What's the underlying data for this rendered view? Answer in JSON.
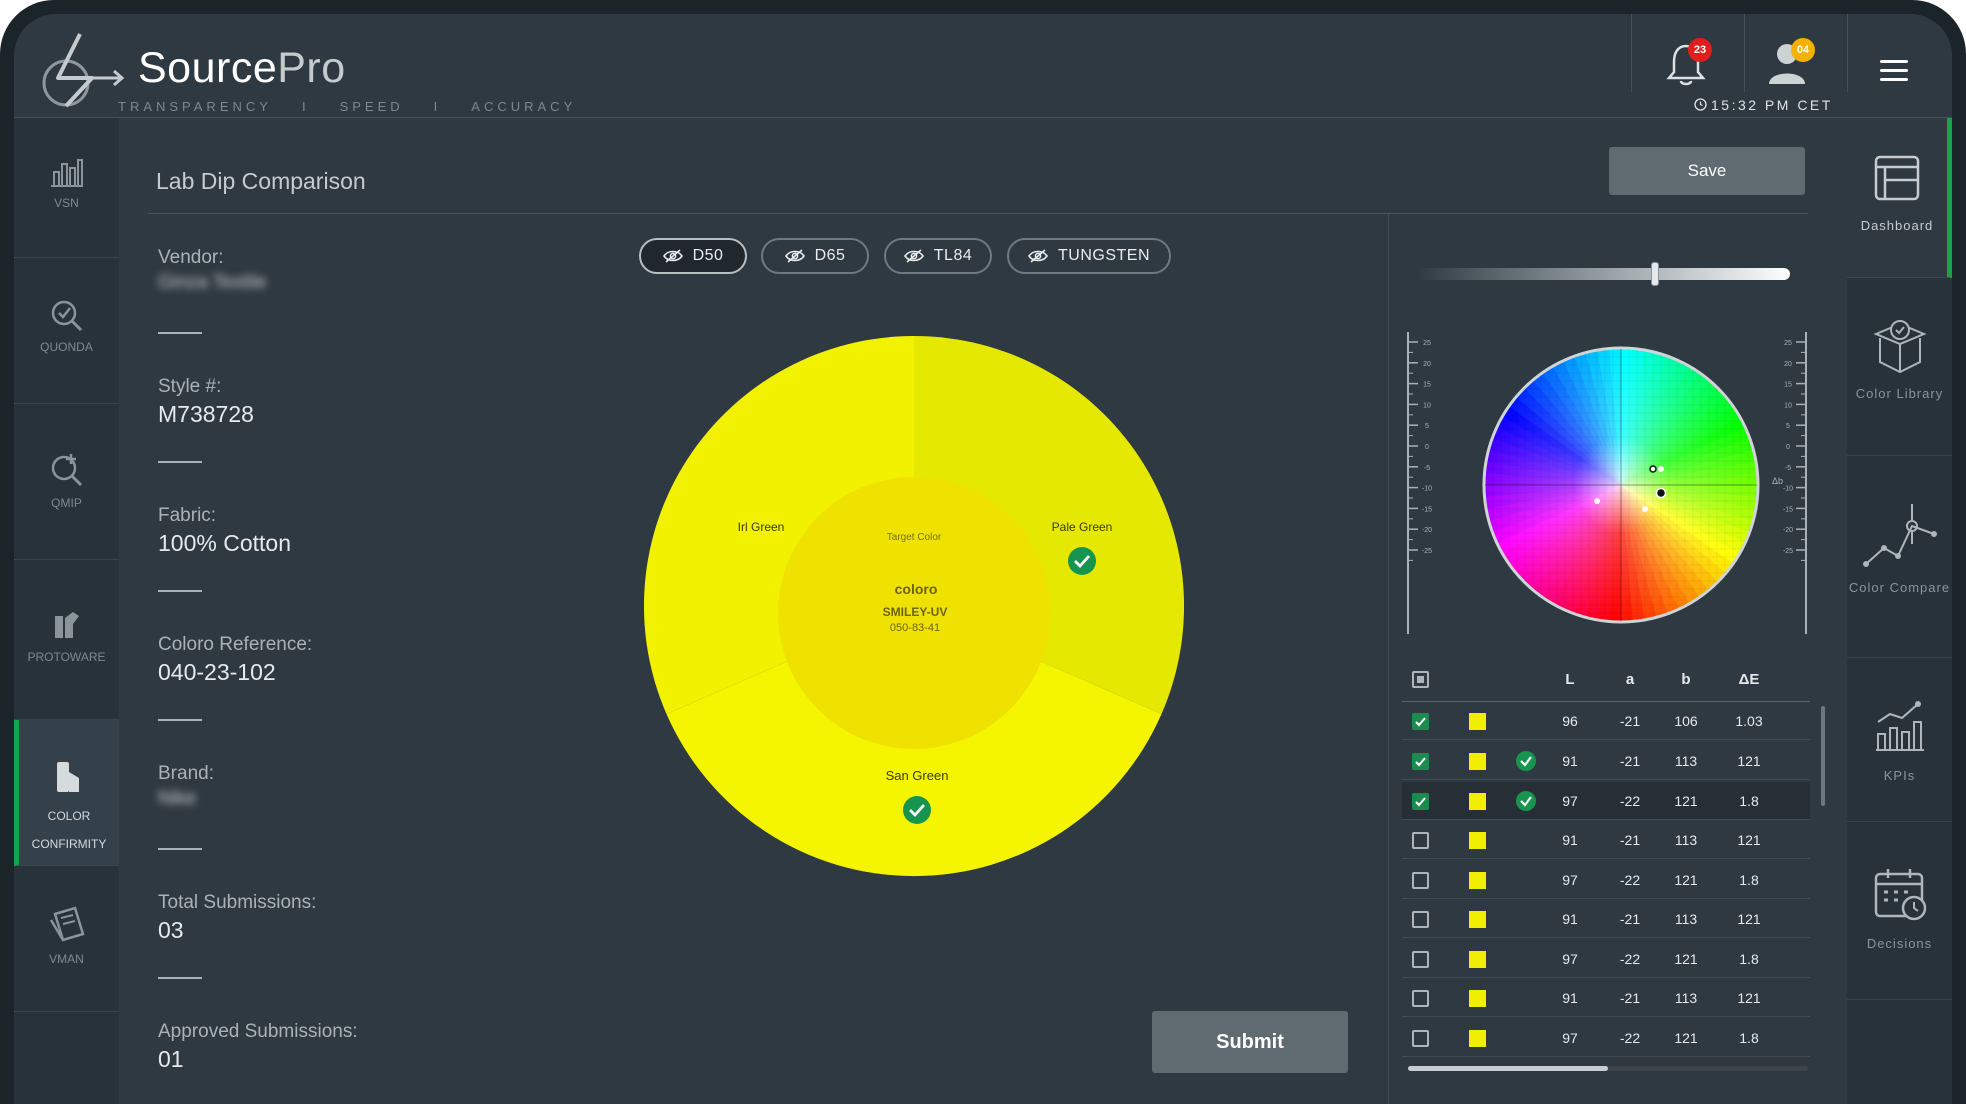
{
  "app": {
    "name": "Source",
    "name_suffix": "Pro",
    "tagline": [
      "TRANSPARENCY",
      "I",
      "SPEED",
      "I",
      "ACCURACY"
    ],
    "clock": "15:32 PM CET",
    "notifications_count": "23",
    "user_badge": "04"
  },
  "left_nav": [
    {
      "label": "VSN",
      "icon": "bar-chart-icon"
    },
    {
      "label": "QUONDA",
      "icon": "magnifier-check-icon"
    },
    {
      "label": "QMIP",
      "icon": "magnifier-plus-icon"
    },
    {
      "label": "PROTOWARE",
      "icon": "garment-icon"
    },
    {
      "label": "COLOR CONFIRMITY",
      "icon": "color-swatch-icon",
      "active": true
    },
    {
      "label": "VMAN",
      "icon": "book-icon"
    }
  ],
  "right_nav": [
    {
      "label": "Dashboard",
      "icon": "dashboard-icon",
      "active": true
    },
    {
      "label": "Color Library",
      "icon": "box-icon"
    },
    {
      "label": "Color Compare",
      "icon": "line-nodes-icon"
    },
    {
      "label": "KPIs",
      "icon": "kpi-chart-icon"
    },
    {
      "label": "Decisions",
      "icon": "calendar-icon"
    }
  ],
  "page": {
    "title": "Lab Dip Comparison",
    "save_label": "Save",
    "submit_label": "Submit"
  },
  "details": {
    "vendor_label": "Vendor:",
    "vendor_value": "Ginza Textile",
    "style_label": "Style #:",
    "style_value": "M738728",
    "fabric_label": "Fabric:",
    "fabric_value": "100% Cotton",
    "coloro_label": "Coloro Reference:",
    "coloro_value": "040-23-102",
    "brand_label": "Brand:",
    "brand_value": "Nike",
    "total_label": "Total Submissions:",
    "total_value": "03",
    "approved_label": "Approved Submissions:",
    "approved_value": "01"
  },
  "illuminants": [
    {
      "label": "D50",
      "selected": true
    },
    {
      "label": "D65",
      "selected": false
    },
    {
      "label": "TL84",
      "selected": false
    },
    {
      "label": "TUNGSTEN",
      "selected": false
    }
  ],
  "wheel": {
    "segments": [
      {
        "label": "Irl Green",
        "color": "#f2f100",
        "checked": false
      },
      {
        "label": "Pale Green",
        "color": "#e5e800",
        "checked": true
      },
      {
        "label": "San Green",
        "color": "#f5f500",
        "checked": true
      }
    ],
    "center": {
      "caption": "Target Color",
      "brand": "coloro",
      "name": "SMILEY-UV",
      "code": "050-83-41",
      "color": "#efe200"
    },
    "check_color": "#17944d"
  },
  "intensity": 0.64,
  "lab_chart": {
    "left_ticks": [
      "25",
      "20",
      "15",
      "10",
      "5",
      "0",
      "-5",
      "-10",
      "-15",
      "-20",
      "-25"
    ],
    "right_ticks": [
      "25",
      "20",
      "15",
      "10",
      "5",
      "0",
      "-5",
      "-10",
      "-15",
      "-20",
      "-25"
    ],
    "right_axis_label": "Δb",
    "points": [
      {
        "a": 4,
        "b": 2,
        "style": "hollow"
      },
      {
        "a": 5,
        "b": -1,
        "style": "filled"
      },
      {
        "a": -3,
        "b": -2,
        "style": "white"
      },
      {
        "a": 5,
        "b": 2,
        "style": "white"
      },
      {
        "a": 3,
        "b": -3,
        "style": "white"
      }
    ]
  },
  "table": {
    "headers": [
      "L",
      "a",
      "b",
      "ΔE"
    ],
    "swatch_color": "#f0ef00",
    "rows": [
      {
        "checked": true,
        "approved": false,
        "L": "96",
        "a": "-21",
        "b": "106",
        "dE": "1.03",
        "highlight": false
      },
      {
        "checked": true,
        "approved": true,
        "L": "91",
        "a": "-21",
        "b": "113",
        "dE": "121",
        "highlight": false
      },
      {
        "checked": true,
        "approved": true,
        "L": "97",
        "a": "-22",
        "b": "121",
        "dE": "1.8",
        "highlight": true
      },
      {
        "checked": false,
        "approved": false,
        "L": "91",
        "a": "-21",
        "b": "113",
        "dE": "121",
        "highlight": false
      },
      {
        "checked": false,
        "approved": false,
        "L": "97",
        "a": "-22",
        "b": "121",
        "dE": "1.8",
        "highlight": false
      },
      {
        "checked": false,
        "approved": false,
        "L": "91",
        "a": "-21",
        "b": "113",
        "dE": "121",
        "highlight": false
      },
      {
        "checked": false,
        "approved": false,
        "L": "97",
        "a": "-22",
        "b": "121",
        "dE": "1.8",
        "highlight": false
      },
      {
        "checked": false,
        "approved": false,
        "L": "91",
        "a": "-21",
        "b": "113",
        "dE": "121",
        "highlight": false
      },
      {
        "checked": false,
        "approved": false,
        "L": "97",
        "a": "-22",
        "b": "121",
        "dE": "1.8",
        "highlight": false
      }
    ]
  },
  "colors": {
    "accent_green": "#16a34a",
    "bg": "#2f3941",
    "badge_red": "#e11d1d",
    "badge_amber": "#f5b100"
  }
}
